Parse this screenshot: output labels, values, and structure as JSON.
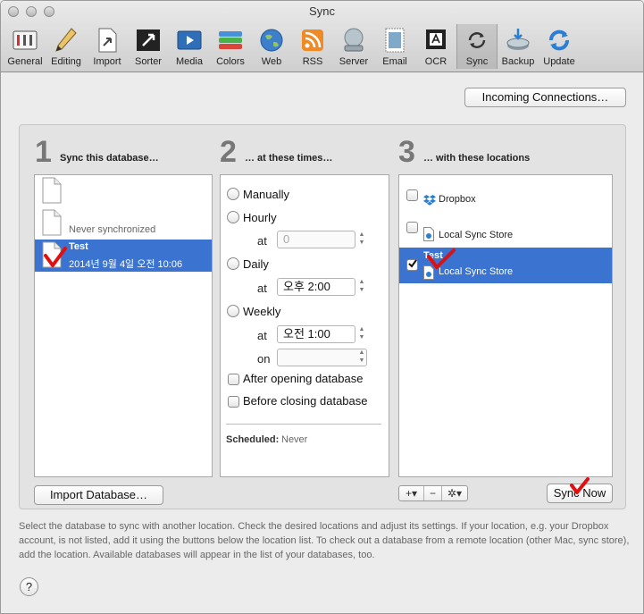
{
  "window": {
    "title": "Sync"
  },
  "toolbar": {
    "items": [
      {
        "label": "General",
        "icon": "general-icon"
      },
      {
        "label": "Editing",
        "icon": "pencil-icon"
      },
      {
        "label": "Import",
        "icon": "import-icon"
      },
      {
        "label": "Sorter",
        "icon": "sorter-icon"
      },
      {
        "label": "Media",
        "icon": "media-icon"
      },
      {
        "label": "Colors",
        "icon": "colors-icon"
      },
      {
        "label": "Web",
        "icon": "globe-icon"
      },
      {
        "label": "RSS",
        "icon": "rss-icon"
      },
      {
        "label": "Server",
        "icon": "server-icon"
      },
      {
        "label": "Email",
        "icon": "stamp-icon"
      },
      {
        "label": "OCR",
        "icon": "ocr-icon"
      },
      {
        "label": "Sync",
        "icon": "sync-icon",
        "selected": true
      },
      {
        "label": "Backup",
        "icon": "backup-icon"
      },
      {
        "label": "Update",
        "icon": "update-icon"
      }
    ]
  },
  "incoming_connections_label": "Incoming Connections…",
  "step1": {
    "number": "1",
    "title": "Sync this database…",
    "databases": [
      {
        "name": "",
        "status": ""
      },
      {
        "name": "",
        "status": "Never synchronized"
      },
      {
        "name": "Test",
        "status": "2014년 9월 4일 오전 10:06",
        "selected": true
      }
    ],
    "import_button": "Import Database…"
  },
  "step2": {
    "number": "2",
    "title": "… at these times…",
    "manually": "Manually",
    "hourly": "Hourly",
    "hourly_at_label": "at",
    "hourly_at_value": "0",
    "daily": "Daily",
    "daily_at_label": "at",
    "daily_at_value": "오후   2:00",
    "weekly": "Weekly",
    "weekly_at_label": "at",
    "weekly_at_value": "오전   1:00",
    "weekly_on_label": "on",
    "weekly_on_value": "",
    "after_opening": "After opening database",
    "before_closing": "Before closing database",
    "scheduled_label": "Scheduled:",
    "scheduled_value": "Never"
  },
  "step3": {
    "number": "3",
    "title": "… with these locations",
    "locations": [
      {
        "name": "",
        "label": "Dropbox",
        "checked": false
      },
      {
        "name": "",
        "label": "Local Sync Store",
        "checked": false
      },
      {
        "name": "Test",
        "label": "Local Sync Store",
        "checked": true,
        "selected": true
      }
    ],
    "add_symbol": "+▾",
    "remove_symbol": "−",
    "gear_symbol": "✲▾",
    "sync_now_label": "Sync Now"
  },
  "description": "Select the database to sync with another location. Check the desired locations and adjust its settings. If your location, e.g. your Dropbox account, is not listed, add it using the buttons below the location list. To check out a database from a remote location (other Mac, sync store), add the location. Available databases will appear in the list of your databases, too.",
  "help_symbol": "?",
  "colors": {
    "selection": "#3a74d0",
    "annotation_check": "#e01010"
  }
}
